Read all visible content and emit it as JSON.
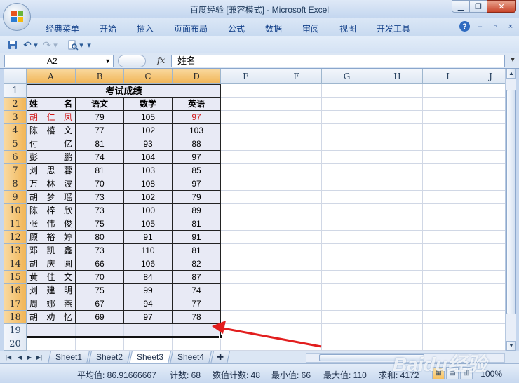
{
  "window": {
    "title": "百度经验  [兼容模式] - Microsoft Excel",
    "minimize": "▁",
    "restore": "❐",
    "close": "✕"
  },
  "ribbon": {
    "tabs": [
      "经典菜单",
      "开始",
      "插入",
      "页面布局",
      "公式",
      "数据",
      "审阅",
      "视图",
      "开发工具"
    ],
    "help": "?",
    "min": "–",
    "restore": "▫",
    "close": "×"
  },
  "qat": {
    "save_icon": "save-icon",
    "undo": "↶",
    "redo": "↷",
    "preview_icon": "print-preview-icon",
    "more": "▾"
  },
  "formula_bar": {
    "name_box": "A2",
    "fx": "fx",
    "content": "姓名"
  },
  "columns": [
    "A",
    "B",
    "C",
    "D",
    "E",
    "F",
    "G",
    "H",
    "I",
    "J"
  ],
  "rows": [
    "1",
    "2",
    "3",
    "4",
    "5",
    "6",
    "7",
    "8",
    "9",
    "10",
    "11",
    "12",
    "13",
    "14",
    "15",
    "16",
    "17",
    "18",
    "19",
    "20"
  ],
  "sheet": {
    "title": "考试成绩",
    "headers": [
      "姓     名",
      "语文",
      "数学",
      "英语"
    ],
    "header_name_chars": [
      "姓",
      "名"
    ],
    "records": [
      {
        "name": [
          "胡",
          "仁",
          "凤"
        ],
        "chinese": "79",
        "math": "105",
        "english": "97",
        "highlight": true
      },
      {
        "name": [
          "陈",
          "禧",
          "文"
        ],
        "chinese": "77",
        "math": "102",
        "english": "103",
        "highlight": false
      },
      {
        "name": [
          "付",
          "亿"
        ],
        "chinese": "81",
        "math": "93",
        "english": "88",
        "highlight": false
      },
      {
        "name": [
          "彭",
          "鹏"
        ],
        "chinese": "74",
        "math": "104",
        "english": "97",
        "highlight": false
      },
      {
        "name": [
          "刘",
          "思",
          "蓉"
        ],
        "chinese": "81",
        "math": "103",
        "english": "85",
        "highlight": false
      },
      {
        "name": [
          "万",
          "林",
          "波"
        ],
        "chinese": "70",
        "math": "108",
        "english": "97",
        "highlight": false
      },
      {
        "name": [
          "胡",
          "梦",
          "瑶"
        ],
        "chinese": "73",
        "math": "102",
        "english": "79",
        "highlight": false
      },
      {
        "name": [
          "陈",
          "梓",
          "欣"
        ],
        "chinese": "73",
        "math": "100",
        "english": "89",
        "highlight": false
      },
      {
        "name": [
          "张",
          "伟",
          "俊"
        ],
        "chinese": "75",
        "math": "105",
        "english": "81",
        "highlight": false
      },
      {
        "name": [
          "顾",
          "裕",
          "婷"
        ],
        "chinese": "80",
        "math": "91",
        "english": "91",
        "highlight": false
      },
      {
        "name": [
          "邓",
          "凯",
          "鑫"
        ],
        "chinese": "73",
        "math": "110",
        "english": "81",
        "highlight": false
      },
      {
        "name": [
          "胡",
          "庆",
          "圆"
        ],
        "chinese": "66",
        "math": "106",
        "english": "82",
        "highlight": false
      },
      {
        "name": [
          "黄",
          "佳",
          "文"
        ],
        "chinese": "70",
        "math": "84",
        "english": "87",
        "highlight": false
      },
      {
        "name": [
          "刘",
          "建",
          "明"
        ],
        "chinese": "75",
        "math": "99",
        "english": "74",
        "highlight": false
      },
      {
        "name": [
          "周",
          "娜",
          "燕"
        ],
        "chinese": "67",
        "math": "94",
        "english": "77",
        "highlight": false
      },
      {
        "name": [
          "胡",
          "劝",
          "忆"
        ],
        "chinese": "69",
        "math": "97",
        "english": "78",
        "highlight": false
      }
    ]
  },
  "sheet_tabs": [
    "Sheet1",
    "Sheet2",
    "Sheet3",
    "Sheet4"
  ],
  "active_sheet": "Sheet3",
  "status": {
    "average": "平均值: 86.91666667",
    "count": "计数: 68",
    "numeric_count": "数值计数: 48",
    "min": "最小值: 66",
    "max": "最大值: 110",
    "sum": "求和: 4172",
    "zoom": "100%"
  },
  "watermark": "Baidu经验",
  "colors": {
    "accent_red": "#d01818",
    "selection_header": "#f1b556",
    "table_fill": "#e8eaf5",
    "arrow": "#e21e1e"
  }
}
